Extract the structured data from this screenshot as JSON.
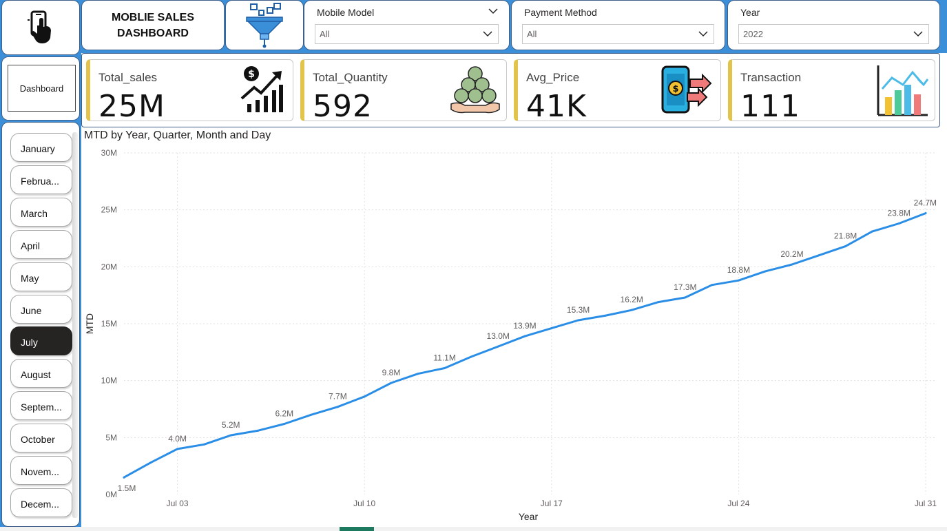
{
  "header": {
    "title_line1": "MOBLIE SALES",
    "title_line2": "DASHBOARD",
    "logo_icon": "mobile-touch-icon",
    "filter_icon": "funnel-icon"
  },
  "slicers": [
    {
      "title": "Mobile Model",
      "value": "All"
    },
    {
      "title": "Payment Method",
      "value": "All"
    },
    {
      "title": "Year",
      "value": "2022"
    }
  ],
  "nav": {
    "dashboard_label": "Dashboard",
    "months": [
      "January",
      "Februa...",
      "March",
      "April",
      "May",
      "June",
      "July",
      "August",
      "Septem...",
      "October",
      "Novem...",
      "Decem..."
    ],
    "active_month": "July"
  },
  "kpis": [
    {
      "label": "Total_sales",
      "value": "25M",
      "icon": "sales-growth-icon"
    },
    {
      "label": "Total_Quantity",
      "value": "592",
      "icon": "coins-hand-icon"
    },
    {
      "label": "Avg_Price",
      "value": "41K",
      "icon": "mobile-payment-icon"
    },
    {
      "label": "Transaction",
      "value": "111",
      "icon": "bar-chart-icon"
    }
  ],
  "colors": {
    "accent_blue": "#3b8fd9",
    "line": "#2a8ee6",
    "kpi_accent": "#e2c34b",
    "active_month_bg": "#252423"
  },
  "chart_data": {
    "type": "line",
    "title": "MTD by Year, Quarter, Month and Day",
    "xlabel": "Year",
    "ylabel": "MTD",
    "xticks": [
      {
        "day": 3,
        "label": "Jul 03"
      },
      {
        "day": 10,
        "label": "Jul 10"
      },
      {
        "day": 17,
        "label": "Jul 17"
      },
      {
        "day": 24,
        "label": "Jul 24"
      },
      {
        "day": 31,
        "label": "Jul 31"
      }
    ],
    "yticks": [
      "0M",
      "5M",
      "10M",
      "15M",
      "20M",
      "25M",
      "30M"
    ],
    "ylim": [
      0,
      30
    ],
    "grid": true,
    "series": [
      {
        "x": [
          1,
          2,
          3,
          4,
          5,
          6,
          7,
          8,
          9,
          10,
          11,
          12,
          13,
          14,
          15,
          16,
          17,
          18,
          19,
          20,
          21,
          22,
          23,
          24,
          25,
          26,
          27,
          28,
          29,
          30,
          31
        ],
        "values": [
          1.5,
          2.8,
          4.0,
          4.4,
          5.2,
          5.6,
          6.2,
          7.0,
          7.7,
          8.6,
          9.8,
          10.6,
          11.1,
          12.1,
          13.0,
          13.9,
          14.6,
          15.3,
          15.7,
          16.2,
          16.9,
          17.3,
          18.4,
          18.8,
          19.6,
          20.2,
          21.0,
          21.8,
          23.1,
          23.8,
          24.7
        ],
        "labels": [
          {
            "day": 1,
            "text": "1.5M"
          },
          {
            "day": 3,
            "text": "4.0M"
          },
          {
            "day": 5,
            "text": "5.2M"
          },
          {
            "day": 7,
            "text": "6.2M"
          },
          {
            "day": 9,
            "text": "7.7M"
          },
          {
            "day": 11,
            "text": "9.8M"
          },
          {
            "day": 13,
            "text": "11.1M"
          },
          {
            "day": 15,
            "text": "13.0M"
          },
          {
            "day": 16,
            "text": "13.9M"
          },
          {
            "day": 18,
            "text": "15.3M"
          },
          {
            "day": 20,
            "text": "16.2M"
          },
          {
            "day": 22,
            "text": "17.3M"
          },
          {
            "day": 24,
            "text": "18.8M"
          },
          {
            "day": 26,
            "text": "20.2M"
          },
          {
            "day": 28,
            "text": "21.8M"
          },
          {
            "day": 30,
            "text": "23.8M"
          },
          {
            "day": 31,
            "text": "24.7M"
          }
        ]
      }
    ]
  }
}
